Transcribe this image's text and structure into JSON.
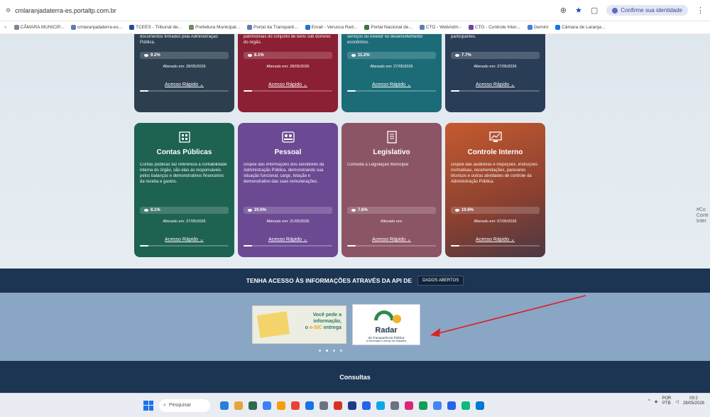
{
  "browser": {
    "url": "cmlaranjadaterra-es.portaltp.com.br",
    "identity_label": "Confirme sua identidade",
    "bookmarks": [
      {
        "label": "CÂMARA MUNICIP...",
        "color": "#7a8899"
      },
      {
        "label": "cmlaranjadaterra-es...",
        "color": "#5a7fb0"
      },
      {
        "label": "TCEES - Tribunal de...",
        "color": "#1f4e8c"
      },
      {
        "label": "Prefeitura Municipal...",
        "color": "#6f8f5a"
      },
      {
        "label": "Portal da Transparê...",
        "color": "#5a7fb0"
      },
      {
        "label": "Email - Verusca Red...",
        "color": "#2b6cd6"
      },
      {
        "label": "Portal Nacional de...",
        "color": "#3a7a3a"
      },
      {
        "label": "CTO - WebAdm -",
        "color": "#5a7fb0"
      },
      {
        "label": "CTO - Controle Inter...",
        "color": "#7b3fa8"
      },
      {
        "label": "Gemini",
        "color": "#4a7be0"
      },
      {
        "label": "Câmara de Laranja...",
        "color": "#1a73e8"
      }
    ]
  },
  "cards_top": [
    {
      "color": "c-dark",
      "desc": "editivos firmados, fornecimentos e documentos firmados pela Administração Pública.",
      "stat": "9.2%",
      "changed": "Alterado em: 28/05/2026",
      "access": "Acesso Rápido"
    },
    {
      "color": "c-red",
      "desc": "Administração Pública e das informações patrimoniais do conjunto de bens sob domínio do órgão.",
      "stat": "8.1%",
      "changed": "Alterado em: 28/05/2026",
      "access": "Acesso Rápido"
    },
    {
      "color": "c-teal",
      "desc": "liquidações e pagamentos para custear serviços ou investir no desenvolvimento econômico.",
      "stat": "11.2%",
      "changed": "Alterado em: 27/05/2026",
      "access": "Acesso Rápido"
    },
    {
      "color": "c-navy",
      "desc": "de atividades de interesse comum aos dos participantes.",
      "stat": "7.7%",
      "changed": "Alterado em: 27/05/2026",
      "access": "Acesso Rápido"
    }
  ],
  "cards_bottom": [
    {
      "color": "c-green",
      "icon": "building-icon",
      "title": "Contas Públicas",
      "desc": "Contas públicas faz referência à contabilidade interna do órgão, são elas as responsáveis pelos balanços e demonstrativos financeiros da receita e gastos.",
      "stat": "8.1%",
      "changed": "Alterado em: 27/05/2026",
      "access": "Acesso Rápido"
    },
    {
      "color": "c-purple",
      "icon": "people-icon",
      "title": "Pessoal",
      "desc": "Dispõe das informações dos servidores da Administração Pública, demonstrando sua situação funcional, cargo, lotação e demonstrativo das suas remunerações.",
      "stat": "20.6%",
      "changed": "Alterado em: 21/05/2026",
      "access": "Acesso Rápido"
    },
    {
      "color": "c-mauve",
      "icon": "document-icon",
      "title": "Legislativo",
      "desc": "Consulta a Legislação Municipal",
      "stat": "7.6%",
      "changed": "Alterado em:",
      "access": "Acesso Rápido"
    },
    {
      "color": "c-orange",
      "icon": "monitor-icon",
      "title": "Controle Interno",
      "desc": "Dispõe das auditorias e inspeções, instruções normativas, recomendações, pareceres técnicos e outras atividades de controle da Administração Pública.",
      "stat": "10.6%",
      "changed": "Alterado em: 07/05/2026",
      "access": "Acesso Rápido"
    }
  ],
  "api_band": {
    "text": "TENHA ACESSO ÀS INFORMAÇÕES ATRAVÉS DA API DE",
    "button": "DADOS ABERTOS"
  },
  "banners": {
    "sic_line1": "Você pede a",
    "sic_line2": "informação,",
    "sic_line3a": "o ",
    "sic_line3b": "e-SIC",
    "sic_line3c": " entrega",
    "radar_name": "Radar",
    "radar_sub1": "da Transparência Pública",
    "radar_sub2": "A informação a serviço da cidadania"
  },
  "consultas": "Consultas",
  "side_fragment": {
    "line1": "#Co",
    "line2": "Contr",
    "line3": "Inter"
  },
  "taskbar": {
    "search_placeholder": "Pesquisar",
    "lang1": "POR",
    "lang2": "PTB",
    "time": "09:2",
    "date": "28/05/2026",
    "apps": [
      "#2a7fd4",
      "#e8a33d",
      "#2d6a4f",
      "#3b82f6",
      "#f59e0b",
      "#ea4335",
      "#1a73e8",
      "#6b7280",
      "#d93025",
      "#1e3a8a",
      "#2563eb",
      "#0ea5e9",
      "#6b7280",
      "#db2777",
      "#0f9d58",
      "#4285f4",
      "#2563eb",
      "#10b981",
      "#0078d4"
    ]
  }
}
